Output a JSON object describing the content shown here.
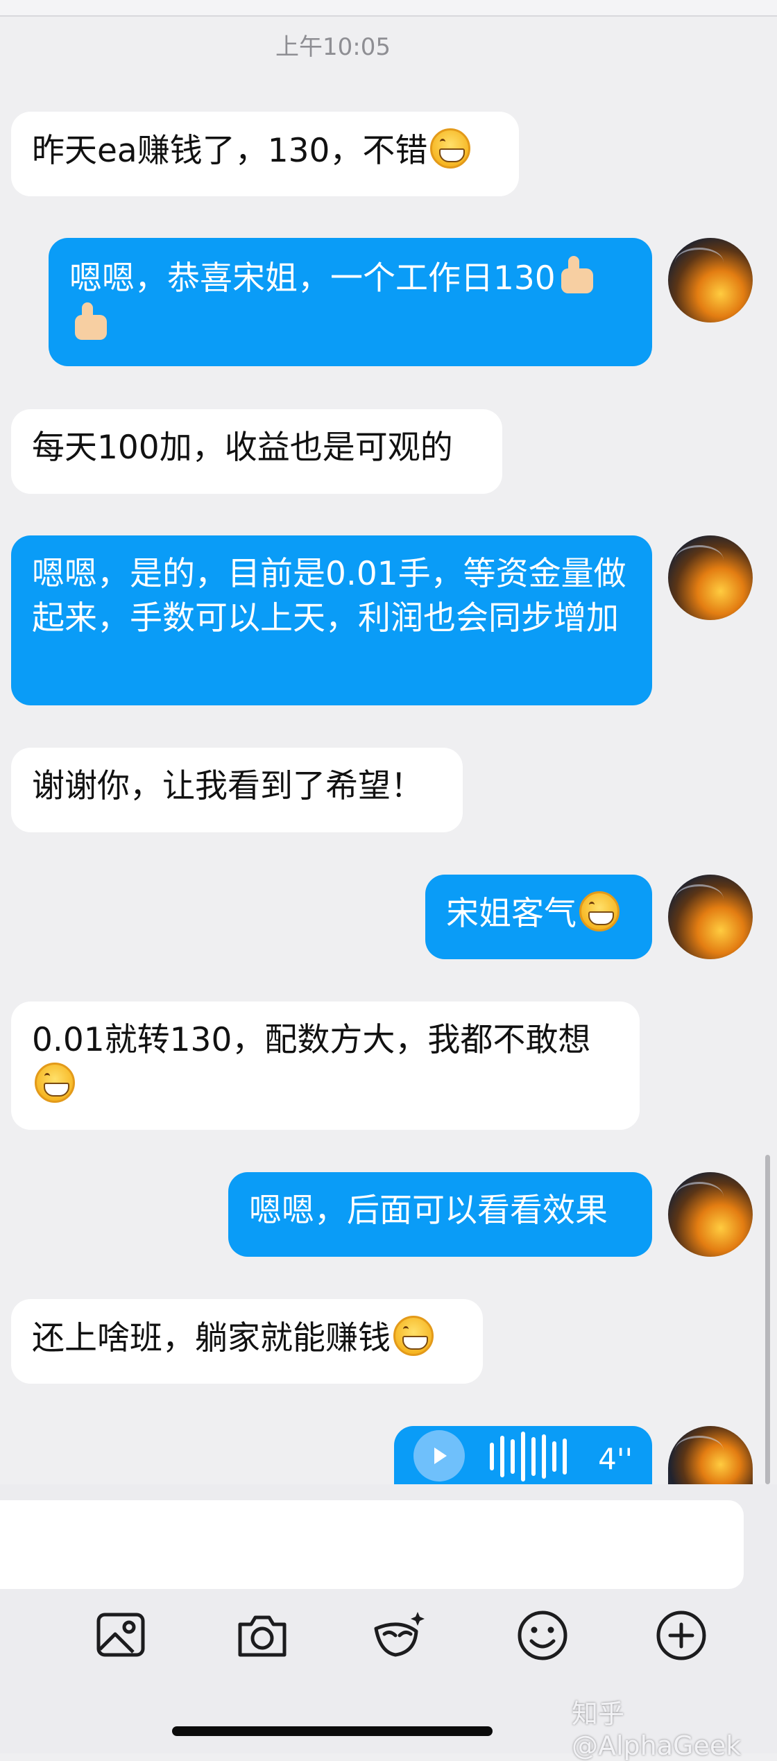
{
  "timestamp": "上午10:05",
  "messages": [
    {
      "side": "in",
      "text": "昨天ea赚钱了，130，不错",
      "emoji": "grin"
    },
    {
      "side": "out",
      "text": "嗯嗯，恭喜宋姐，一个工作日130",
      "emoji": "thumbs-up-x2"
    },
    {
      "side": "in",
      "text": "每天100加，收益也是可观的"
    },
    {
      "side": "out",
      "text": "嗯嗯，是的，目前是0.01手，等资金量做起来，手数可以上天，利润也会同步增加"
    },
    {
      "side": "in",
      "text": "谢谢你，让我看到了希望！"
    },
    {
      "side": "out",
      "text": "宋姐客气",
      "emoji": "grin"
    },
    {
      "side": "in",
      "text": "0.01就转130，配数方大，我都不敢想",
      "emoji": "grin"
    },
    {
      "side": "out",
      "text": "嗯嗯，后面可以看看效果"
    },
    {
      "side": "in",
      "text": "还上啥班，躺家就能赚钱",
      "emoji": "grin"
    },
    {
      "side": "out",
      "type": "voice",
      "duration": "4''"
    }
  ],
  "toolbar": {
    "icons": [
      "image-icon",
      "camera-icon",
      "mask-sticker-icon",
      "smiley-icon",
      "plus-circle-icon"
    ]
  },
  "watermark": "知乎 @AlphaGeek",
  "colors": {
    "outgoing": "#0a9cf7",
    "incoming": "#ffffff",
    "background": "#efeff1"
  }
}
